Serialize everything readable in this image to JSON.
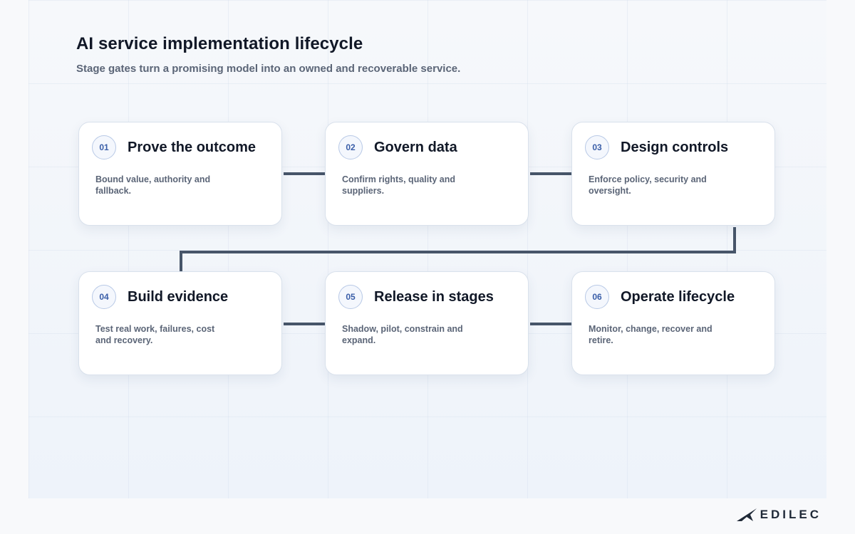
{
  "header": {
    "title": "AI service implementation lifecycle",
    "subtitle": "Stage gates turn a promising model into an owned and recoverable service."
  },
  "stages": [
    {
      "number": "01",
      "title": "Prove the outcome",
      "description": "Bound value, authority and fallback."
    },
    {
      "number": "02",
      "title": "Govern data",
      "description": "Confirm rights, quality and suppliers."
    },
    {
      "number": "03",
      "title": "Design controls",
      "description": "Enforce policy, security and oversight."
    },
    {
      "number": "04",
      "title": "Build evidence",
      "description": "Test real work, failures, cost and recovery."
    },
    {
      "number": "05",
      "title": "Release in stages",
      "description": "Shadow, pilot, constrain and expand."
    },
    {
      "number": "06",
      "title": "Operate lifecycle",
      "description": "Monitor, change, recover and retire."
    }
  ],
  "brand": {
    "name": "EDILEC",
    "icon": "jet-icon"
  },
  "colors": {
    "connector": "#475569",
    "badge_text": "#3a5ea8",
    "title": "#111827"
  }
}
